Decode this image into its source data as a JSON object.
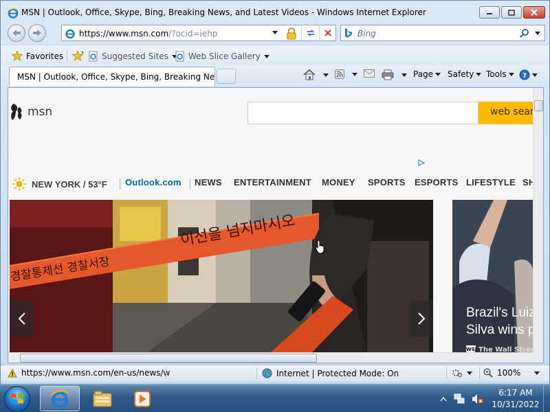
{
  "window": {
    "title": "MSN | Outlook, Office, Skype, Bing, Breaking News, and Latest Videos - Windows Internet Explorer"
  },
  "address_bar": {
    "url_scheme": "https://",
    "url_host": "www.msn.com",
    "url_rest": "/?ocid=iehp"
  },
  "search": {
    "placeholder": "Bing"
  },
  "favorites_bar": {
    "favorites_label": "Favorites",
    "items": [
      {
        "label": "Suggested Sites",
        "icon": "ie-page-icon"
      },
      {
        "label": "Web Slice Gallery",
        "icon": "ie-page-icon"
      }
    ]
  },
  "tab": {
    "title": "MSN | Outlook, Office, Skype, Bing, Breaking Ne..."
  },
  "command_bar": {
    "page_label": "Page",
    "safety_label": "Safety",
    "tools_label": "Tools"
  },
  "page": {
    "search_button": "web search",
    "weather": "NEW YORK / 53°F",
    "nav": [
      "Outlook.com",
      "NEWS",
      "ENTERTAINMENT",
      "MONEY",
      "SPORTS",
      "ESPORTS",
      "LIFESTYLE",
      "SHOPPING"
    ],
    "hero": {
      "tape_text_1": "이선을 넘지마시오",
      "tape_text_2": "경찰통제선 경찰서장"
    },
    "side_story": {
      "headline_line1": "Brazil's Luiz Inácio Lula da",
      "headline_line2": "Silva wins presidency",
      "source": "The Wall Street Journal",
      "source_logo": "WSJ"
    }
  },
  "status_bar": {
    "link_url": "https://www.msn.com/en-us/news/w",
    "zone": "Internet | Protected Mode: On",
    "zoom": "100%"
  },
  "taskbar": {
    "time": "6:17 AM",
    "date": "10/31/2022"
  },
  "colors": {
    "search_button": "#ffb900",
    "outlook_link": "#0067b8",
    "close_button": "#c7432b",
    "taskbar": "#2f5a8a"
  }
}
